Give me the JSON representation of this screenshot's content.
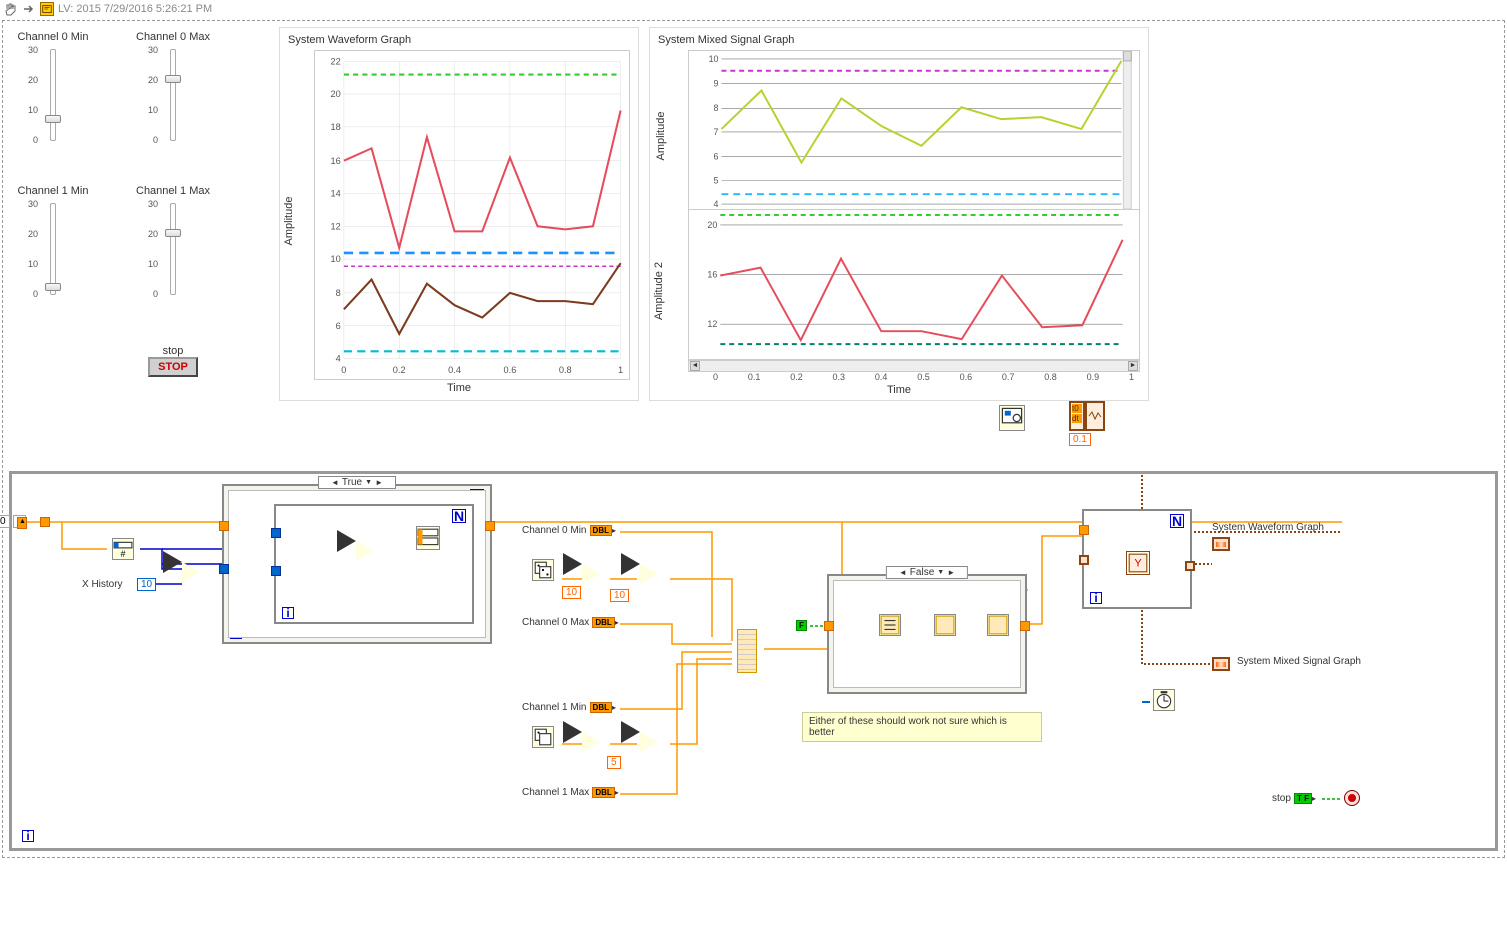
{
  "header": {
    "title": "LV: 2015 7/29/2016 5:26:21 PM"
  },
  "sliders": {
    "ch0min": {
      "label": "Channel 0 Min",
      "ticks": [
        "30",
        "20",
        "10",
        "0"
      ],
      "pos": 88
    },
    "ch0max": {
      "label": "Channel 0 Max",
      "ticks": [
        "30",
        "20",
        "10",
        "0"
      ],
      "pos": 35
    },
    "ch1min": {
      "label": "Channel 1 Min",
      "ticks": [
        "30",
        "20",
        "10",
        "0"
      ],
      "pos": 88
    },
    "ch1max": {
      "label": "Channel 1 Max",
      "ticks": [
        "30",
        "20",
        "10",
        "0"
      ],
      "pos": 35
    }
  },
  "stop": {
    "label": "stop",
    "button": "STOP"
  },
  "graph1": {
    "title": "System Waveform Graph",
    "xlabel": "Time",
    "ylabel": "Amplitude",
    "xticks": [
      "0",
      "0.2",
      "0.4",
      "0.6",
      "0.8",
      "1"
    ],
    "yticks": [
      "22",
      "20",
      "18",
      "16",
      "14",
      "12",
      "10",
      "8",
      "6",
      "4"
    ]
  },
  "graph2": {
    "title": "System Mixed Signal Graph",
    "xlabel": "Time",
    "ylabel_top": "Amplitude",
    "ylabel_bot": "Amplitude 2",
    "xticks": [
      "0",
      "0.1",
      "0.2",
      "0.3",
      "0.4",
      "0.5",
      "0.6",
      "0.7",
      "0.8",
      "0.9",
      "1"
    ],
    "yticks_top": [
      "10",
      "9",
      "8",
      "7",
      "6",
      "5",
      "4"
    ],
    "yticks_bot": [
      "20",
      "16",
      "12"
    ]
  },
  "chart_data": [
    {
      "type": "line",
      "title": "System Waveform Graph",
      "xlabel": "Time",
      "ylabel": "Amplitude",
      "x": [
        0,
        0.1,
        0.2,
        0.3,
        0.4,
        0.5,
        0.6,
        0.7,
        0.8,
        0.9,
        1.0
      ],
      "ylim": [
        4,
        22
      ],
      "series": [
        {
          "name": "red",
          "color": "#e74c5c",
          "values": [
            16,
            16.7,
            10.7,
            17.4,
            11.5,
            11.5,
            16,
            12,
            11.8,
            12,
            19
          ]
        },
        {
          "name": "brown",
          "color": "#7a3b1f",
          "values": [
            7,
            8.8,
            5.5,
            8.5,
            7.2,
            6.5,
            8,
            7.5,
            7.5,
            7.3,
            9.8
          ]
        },
        {
          "name": "green-dash",
          "color": "#33cc33",
          "style": "dash",
          "constant": 21.2
        },
        {
          "name": "blue-dash",
          "color": "#1e90ff",
          "style": "dash",
          "constant": 10.4
        },
        {
          "name": "magenta-dash",
          "color": "#cc33cc",
          "style": "dash",
          "constant": 9.6
        },
        {
          "name": "cyan-dash",
          "color": "#00bcd4",
          "style": "dash",
          "constant": 4.4
        }
      ]
    },
    {
      "type": "line",
      "title": "System Mixed Signal Graph",
      "xlabel": "Time",
      "panels": [
        {
          "ylabel": "Amplitude",
          "ylim": [
            4,
            10
          ],
          "series": [
            {
              "name": "yellow-green",
              "color": "#b8d12f",
              "x": [
                0,
                0.1,
                0.2,
                0.3,
                0.4,
                0.5,
                0.6,
                0.7,
                0.8,
                0.9,
                1.0
              ],
              "values": [
                7.1,
                8.7,
                5.7,
                8.4,
                7.2,
                6.4,
                8,
                7.5,
                7.6,
                7.1,
                9.9
              ]
            },
            {
              "name": "magenta-dash",
              "color": "#cc33cc",
              "style": "dash",
              "constant": 9.5
            },
            {
              "name": "cyan-dash",
              "color": "#29b6f6",
              "style": "dash",
              "constant": 4.4
            }
          ]
        },
        {
          "ylabel": "Amplitude 2",
          "ylim": [
            10,
            21
          ],
          "series": [
            {
              "name": "red",
              "color": "#e74c5c",
              "x": [
                0,
                0.1,
                0.2,
                0.3,
                0.4,
                0.5,
                0.6,
                0.7,
                0.8,
                0.9,
                1.0
              ],
              "values": [
                16,
                16.7,
                10.7,
                17.4,
                11.5,
                11.5,
                10.8,
                16,
                11.8,
                12,
                19
              ]
            },
            {
              "name": "green-dash",
              "color": "#33cc33",
              "style": "dash",
              "constant": 21
            },
            {
              "name": "teal-dash",
              "color": "#008066",
              "style": "dash",
              "constant": 10.4
            }
          ]
        }
      ]
    }
  ],
  "bd": {
    "x_history_label": "X History",
    "x_history_const": "10",
    "case_true": "True",
    "case_false": "False",
    "ch0min": {
      "label": "Channel 0 Min",
      "type": "DBL"
    },
    "ch0max": {
      "label": "Channel 0 Max",
      "type": "DBL"
    },
    "ch1min": {
      "label": "Channel 1 Min",
      "type": "DBL"
    },
    "ch1max": {
      "label": "Channel 1 Max",
      "type": "DBL"
    },
    "const10a": "10",
    "const10b": "10",
    "const5": "5",
    "comment": "Either of these should work not sure which is better",
    "wf_graph_label": "System Waveform Graph",
    "mixed_graph_label": "System Mixed Signal Graph",
    "stop_label": "stop",
    "stop_tf": "T F",
    "t0": "t0",
    "dt": "dt",
    "dt_val": "0.1",
    "false_const": "F",
    "init_const": "0"
  }
}
